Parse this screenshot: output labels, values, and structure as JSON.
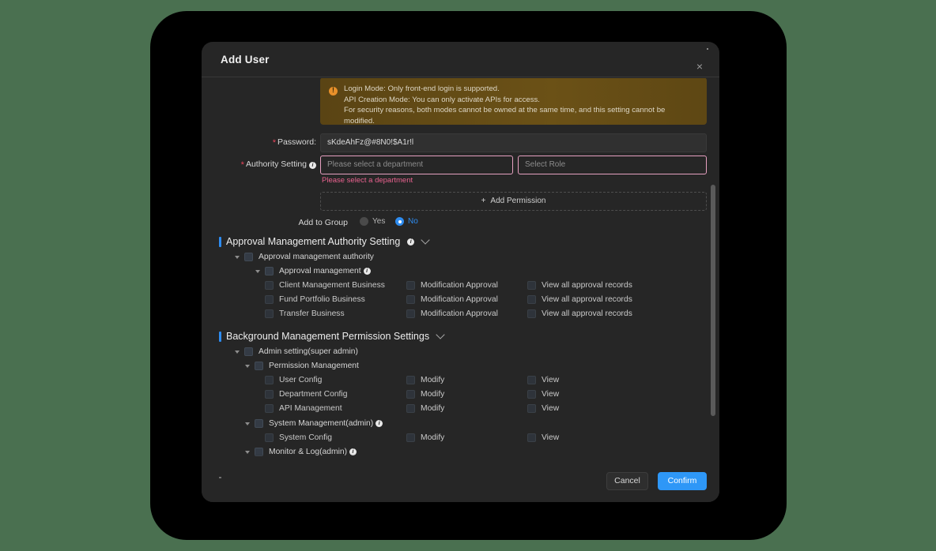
{
  "window": {
    "background_color": "#4a7050",
    "frame_color": "#000000"
  },
  "modal": {
    "title": "Add User",
    "close_icon": "×",
    "accent_color": "#2e97f7"
  },
  "banner": {
    "icon": "warning-icon",
    "line1": "Login Mode: Only front-end login is supported.",
    "line2": "API Creation Mode: You can only activate APIs for access.",
    "line3": "For security reasons, both modes cannot be owned at the same time, and this setting cannot be",
    "line4": "modified."
  },
  "form": {
    "password": {
      "label": "Password:",
      "required": true,
      "value": "sKdeAhFz@#8N0!$A1r!l"
    },
    "authority": {
      "label": "Authority Setting",
      "required": true,
      "department_placeholder": "Please select a department",
      "role_placeholder": "Select Role",
      "error": "Please select a department"
    },
    "add_permission": {
      "plus": "+",
      "label": "Add Permission"
    },
    "add_to_group": {
      "label": "Add to Group",
      "options": [
        "Yes",
        "No"
      ],
      "selected": "No"
    }
  },
  "approval_section": {
    "title": "Approval Management Authority Setting",
    "node1": "Approval management authority",
    "node2": "Approval management",
    "rows": [
      {
        "c1": "Client Management Business",
        "c2": "Modification Approval",
        "c3": "View all approval records"
      },
      {
        "c1": "Fund Portfolio Business",
        "c2": "Modification Approval",
        "c3": "View all approval records"
      },
      {
        "c1": "Transfer Business",
        "c2": "Modification Approval",
        "c3": "View all approval records"
      }
    ]
  },
  "background_section": {
    "title": "Background Management Permission Settings",
    "node1": "Admin setting(super admin)",
    "node2": "Permission Management",
    "rows": [
      {
        "c1": "User Config",
        "c2": "Modify",
        "c3": "View"
      },
      {
        "c1": "Department Config",
        "c2": "Modify",
        "c3": "View"
      },
      {
        "c1": "API Management",
        "c2": "Modify",
        "c3": "View"
      }
    ],
    "node3": "System Management(admin)",
    "rows2": [
      {
        "c1": "System Config",
        "c2": "Modify",
        "c3": "View"
      }
    ],
    "node4": "Monitor & Log(admin)"
  },
  "footer": {
    "cancel": "Cancel",
    "confirm": "Confirm"
  }
}
